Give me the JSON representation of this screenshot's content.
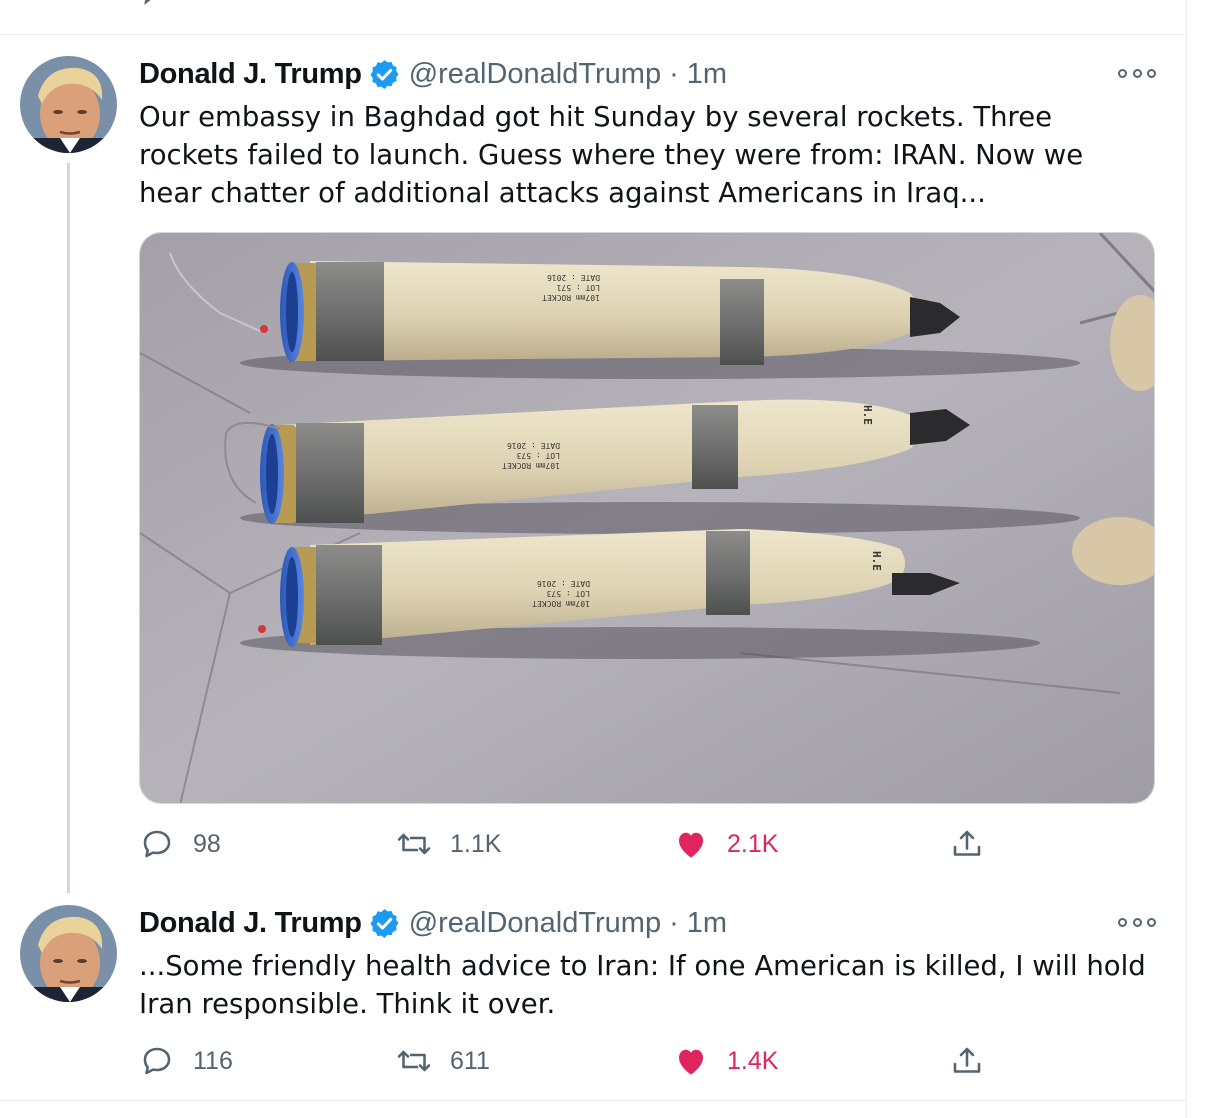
{
  "tweets": [
    {
      "name": "Donald J. Trump",
      "handle": "@realDonaldTrump",
      "separator": "·",
      "time": "1m",
      "text": "Our embassy in Baghdad got hit Sunday by several rockets. Three rockets failed to launch. Guess where they were from: IRAN. Now we hear chatter of additional attacks against Americans in Iraq...",
      "media": {
        "rockets": [
          {
            "label": "107mm ROCKET",
            "line2": "LOT : 571",
            "line3": "DATE : 2016"
          },
          {
            "label": "107mm ROCKET",
            "line2": "LOT : 573",
            "line3": "DATE : 2016",
            "nose": "H.E"
          },
          {
            "label": "107mm ROCKET",
            "line2": "LOT : 573",
            "line3": "DATE : 2016",
            "nose": "H.E"
          }
        ]
      },
      "reply_count": "98",
      "retweet_count": "1.1K",
      "like_count": "2.1K",
      "liked": true
    },
    {
      "name": "Donald J. Trump",
      "handle": "@realDonaldTrump",
      "separator": "·",
      "time": "1m",
      "text": "...Some friendly health advice to Iran: If one American is killed, I will hold Iran responsible. Think it over.",
      "reply_count": "116",
      "retweet_count": "611",
      "like_count": "1.4K",
      "liked": true
    }
  ],
  "colors": {
    "like": "#e0245e",
    "verified": "#1d9bf0",
    "muted": "#536471",
    "border": "#e6ecf0"
  },
  "icons": [
    "reply-icon",
    "retweet-icon",
    "like-icon",
    "share-icon",
    "more-icon",
    "verified-badge-icon"
  ]
}
